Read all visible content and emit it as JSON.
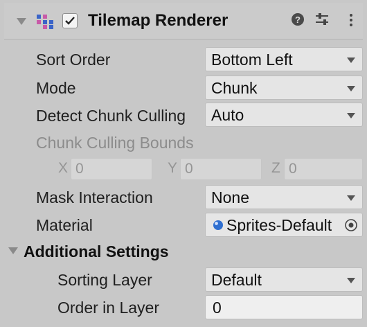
{
  "component": {
    "title": "Tilemap Renderer",
    "enabled": true,
    "icons": [
      "fold-arrow-icon",
      "tilemap-renderer-icon",
      "checkbox",
      "help-icon",
      "presets-icon",
      "kebab-menu-icon"
    ]
  },
  "fields": {
    "sort_order": {
      "label": "Sort Order",
      "value": "Bottom Left"
    },
    "mode": {
      "label": "Mode",
      "value": "Chunk"
    },
    "detect_chunk_culling": {
      "label": "Detect Chunk Culling",
      "value": "Auto"
    },
    "chunk_culling_bounds": {
      "label": "Chunk Culling Bounds",
      "x_label": "X",
      "x": "0",
      "y_label": "Y",
      "y": "0",
      "z_label": "Z",
      "z": "0"
    },
    "mask_interaction": {
      "label": "Mask Interaction",
      "value": "None"
    },
    "material": {
      "label": "Material",
      "value": "Sprites-Default"
    }
  },
  "additional_settings": {
    "title": "Additional Settings",
    "sorting_layer": {
      "label": "Sorting Layer",
      "value": "Default"
    },
    "order_in_layer": {
      "label": "Order in Layer",
      "value": "0"
    }
  }
}
